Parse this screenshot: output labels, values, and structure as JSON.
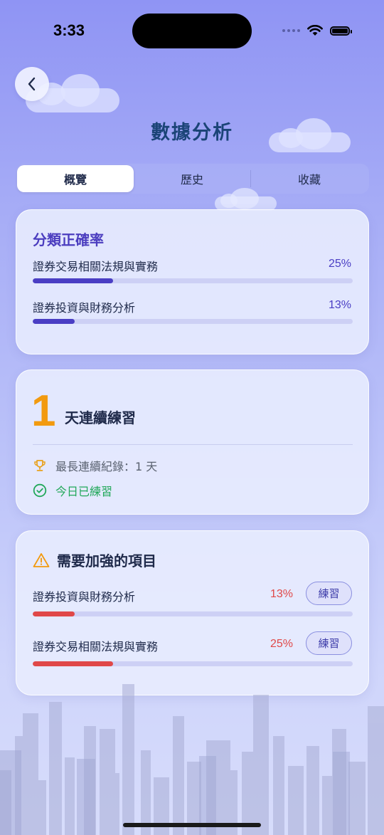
{
  "status_bar": {
    "time": "3:33"
  },
  "header": {
    "back_icon": "chevron-left-icon",
    "title": "數據分析"
  },
  "tabs": [
    {
      "label": "概覽",
      "active": true
    },
    {
      "label": "歷史",
      "active": false
    },
    {
      "label": "收藏",
      "active": false
    }
  ],
  "accuracy": {
    "title": "分類正確率",
    "accent_color": "#4a3ec4",
    "items": [
      {
        "label": "證券交易相關法規與實務",
        "percent_text": "25%",
        "fraction": 0.25
      },
      {
        "label": "證券投資與財務分析",
        "percent_text": "13%",
        "fraction": 0.13
      }
    ]
  },
  "streak": {
    "count": "1",
    "label": "天連續練習",
    "best_icon": "trophy-icon",
    "best_text": "最長連續紀錄：1 天",
    "today_icon": "check-circle-icon",
    "today_text": "今日已練習",
    "count_color": "#f29a0f",
    "today_color": "#22a85a"
  },
  "weak": {
    "icon": "warning-icon",
    "title": "需要加強的項目",
    "accent_color": "#e04848",
    "items": [
      {
        "label": "證券投資與財務分析",
        "percent_text": "13%",
        "fraction": 0.13,
        "button": "練習"
      },
      {
        "label": "證券交易相關法規與實務",
        "percent_text": "25%",
        "fraction": 0.25,
        "button": "練習"
      }
    ]
  }
}
